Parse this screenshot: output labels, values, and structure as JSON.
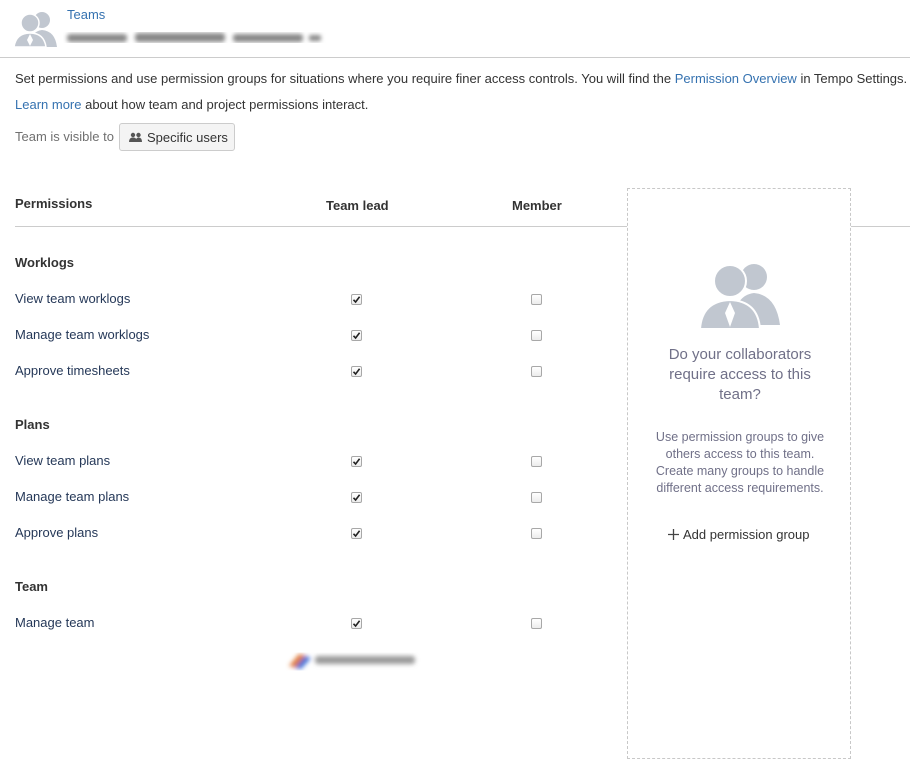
{
  "header": {
    "breadcrumb": "Teams"
  },
  "intro": {
    "text_before": "Set permissions and use permission groups for situations where you require finer access controls. You will find the ",
    "link_text": "Permission Overview",
    "text_after": " in Tempo Settings."
  },
  "learn": {
    "link_text": "Learn more",
    "text_after": " about how team and project permissions interact."
  },
  "visibility": {
    "label": "Team is visible to",
    "button_label": "Specific users",
    "icon": "users-icon"
  },
  "table": {
    "col_permissions": "Permissions",
    "col_lead": "Team lead",
    "col_member": "Member"
  },
  "sections": [
    {
      "title": "Worklogs",
      "rows": [
        {
          "label": "View team worklogs",
          "lead": true,
          "member": false
        },
        {
          "label": "Manage team worklogs",
          "lead": true,
          "member": false
        },
        {
          "label": "Approve timesheets",
          "lead": true,
          "member": false
        }
      ]
    },
    {
      "title": "Plans",
      "rows": [
        {
          "label": "View team plans",
          "lead": true,
          "member": false
        },
        {
          "label": "Manage team plans",
          "lead": true,
          "member": false
        },
        {
          "label": "Approve plans",
          "lead": true,
          "member": false
        }
      ]
    },
    {
      "title": "Team",
      "rows": [
        {
          "label": "Manage team",
          "lead": true,
          "member": false
        }
      ]
    }
  ],
  "panel": {
    "question": "Do your collaborators require access to this team?",
    "description": "Use permission groups to give others access to this team. Create many groups to handle different access requirements.",
    "add_label": "Add permission group",
    "icon": "team-users-icon"
  },
  "colors": {
    "link": "#3572b0",
    "border": "#cccccc",
    "panel_text": "#707088",
    "icon_gray": "#c1c7d0"
  }
}
